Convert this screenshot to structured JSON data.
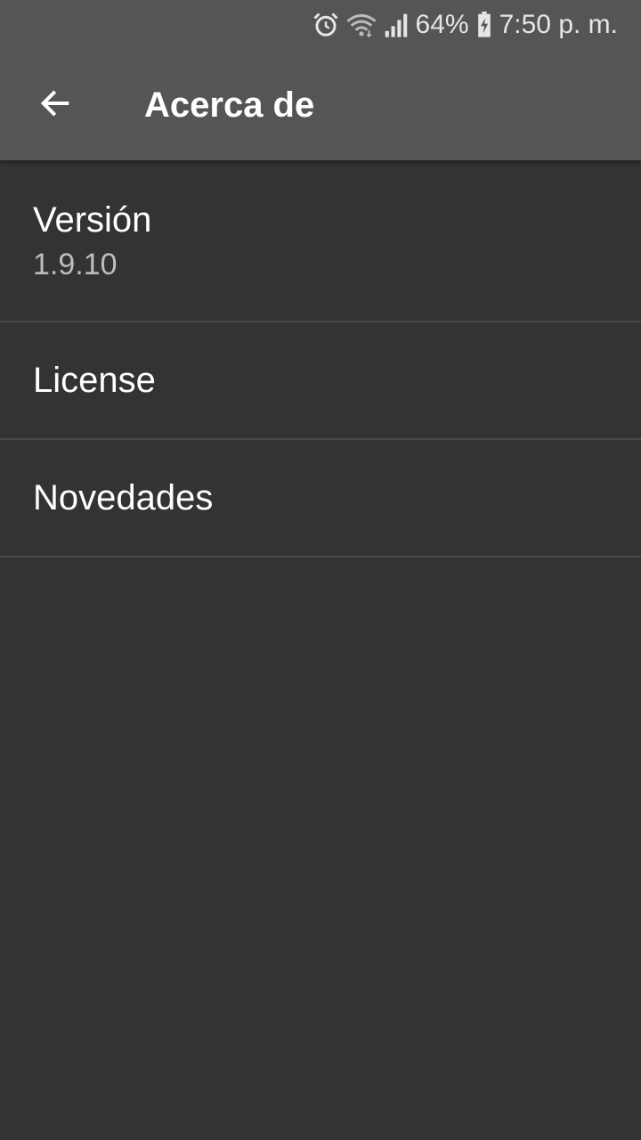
{
  "status_bar": {
    "battery": "64%",
    "time": "7:50 p. m.",
    "icons": [
      "alarm-icon",
      "wifi-icon",
      "signal-icon",
      "battery-charging-icon"
    ]
  },
  "toolbar": {
    "back_icon": "arrow-left-icon",
    "title": "Acerca de"
  },
  "items": [
    {
      "title": "Versión",
      "summary": "1.9.10"
    },
    {
      "title": "License"
    },
    {
      "title": "Novedades"
    }
  ],
  "colors": {
    "bar": "#555555",
    "background": "#333333",
    "divider": "#4a4a4a",
    "summary_text": "#bdbdbd"
  }
}
